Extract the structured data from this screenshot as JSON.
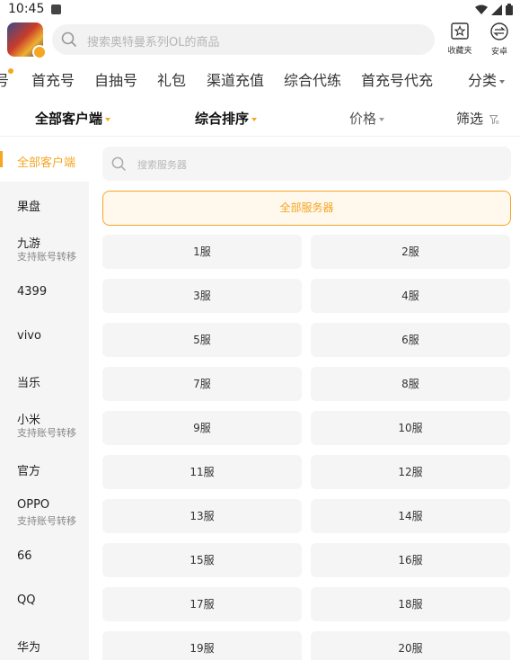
{
  "status": {
    "time": "10:45"
  },
  "header": {
    "search_placeholder": "搜索奥特曼系列OL的商品",
    "favorites_label": "收藏夹",
    "platform_label": "安卓"
  },
  "tabs": {
    "partial": "号",
    "items": [
      "首充号",
      "自抽号",
      "礼包",
      "渠道充值",
      "综合代练",
      "首充号代充"
    ],
    "category": "分类"
  },
  "sort_bar": {
    "client": "全部客户端",
    "order": "综合排序",
    "price": "价格",
    "filter": "筛选"
  },
  "sidebar": {
    "items": [
      {
        "name": "全部客户端",
        "sub": ""
      },
      {
        "name": "果盘",
        "sub": ""
      },
      {
        "name": "九游",
        "sub": "支持账号转移"
      },
      {
        "name": "4399",
        "sub": ""
      },
      {
        "name": "vivo",
        "sub": ""
      },
      {
        "name": "当乐",
        "sub": ""
      },
      {
        "name": "小米",
        "sub": "支持账号转移"
      },
      {
        "name": "官方",
        "sub": ""
      },
      {
        "name": "OPPO",
        "sub": "支持账号转移"
      },
      {
        "name": "66",
        "sub": ""
      },
      {
        "name": "QQ",
        "sub": ""
      },
      {
        "name": "华为",
        "sub": ""
      }
    ]
  },
  "servers": {
    "search_placeholder": "搜索服务器",
    "all_label": "全部服务器",
    "items": [
      "1服",
      "2服",
      "3服",
      "4服",
      "5服",
      "6服",
      "7服",
      "8服",
      "9服",
      "10服",
      "11服",
      "12服",
      "13服",
      "14服",
      "15服",
      "16服",
      "17服",
      "18服",
      "19服",
      "20服"
    ]
  },
  "colors": {
    "accent": "#f5a623"
  }
}
